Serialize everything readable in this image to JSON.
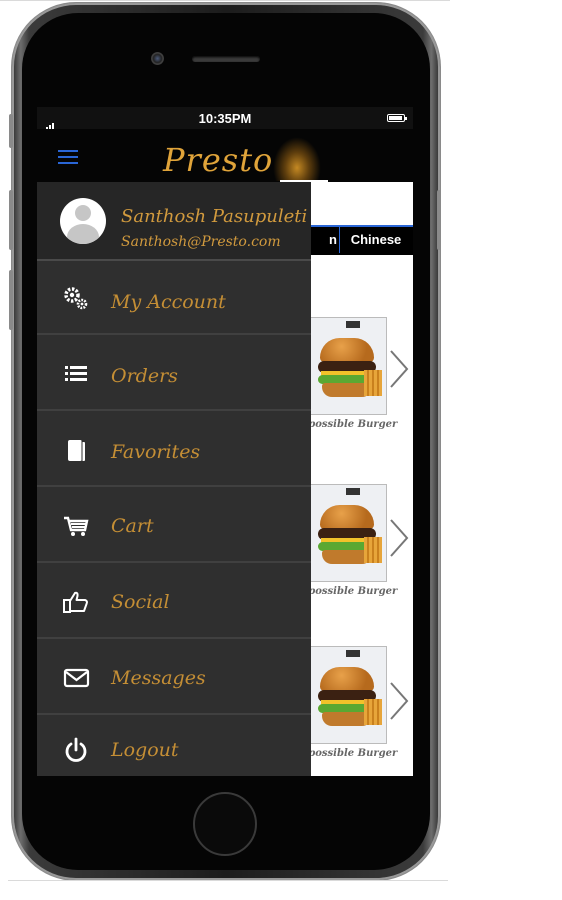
{
  "status_bar": {
    "time": "10:35PM"
  },
  "app": {
    "brand": "Presto"
  },
  "tabs": {
    "italian_partial": "n",
    "chinese": "Chinese"
  },
  "food_items": [
    {
      "name": "Impossible Burger"
    },
    {
      "name": "Impossible Burger"
    },
    {
      "name": "Impossible Burger"
    }
  ],
  "drawer": {
    "profile": {
      "name": "Santhosh Pasupuleti",
      "email": "Santhosh@Presto.com"
    },
    "items": [
      {
        "label": "My Account",
        "icon": "gears-icon"
      },
      {
        "label": "Orders",
        "icon": "list-icon"
      },
      {
        "label": "Favorites",
        "icon": "book-icon"
      },
      {
        "label": "Cart",
        "icon": "cart-icon"
      },
      {
        "label": "Social",
        "icon": "thumbs-up-icon"
      },
      {
        "label": "Messages",
        "icon": "envelope-icon"
      },
      {
        "label": "Logout",
        "icon": "power-icon"
      }
    ]
  },
  "colors": {
    "accent_gold": "#c48e35",
    "drawer_bg": "#2f2f2f",
    "tab_accent": "#2a66d6"
  }
}
